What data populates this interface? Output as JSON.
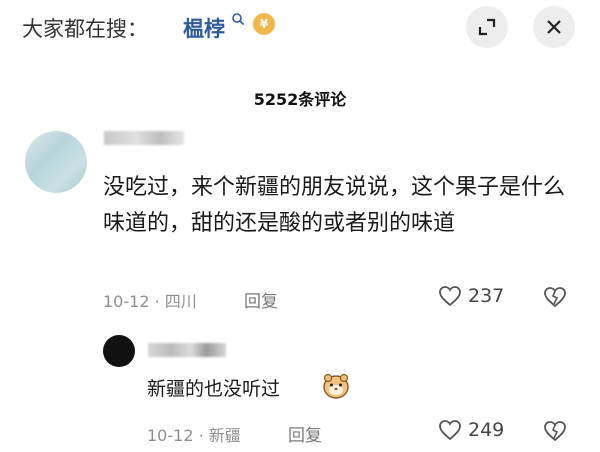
{
  "header": {
    "search_prefix": "大家都在搜：",
    "search_term": "榅桲",
    "coin_symbol": "¥"
  },
  "comments_title": "5252条评论",
  "comment": {
    "text": "没吃过，来个新疆的朋友说说，这个果子是什么味道的，甜的还是酸的或者别的味道",
    "meta": "10-12 · 四川",
    "reply_label": "回复",
    "likes": "237"
  },
  "reply": {
    "text": "新疆的也没听过",
    "meta": "10-12 · 新疆",
    "reply_label": "回复",
    "likes": "249"
  },
  "colors": {
    "search_term": "#2f5c9c",
    "coin": "#f2b84b",
    "button_bg": "#ededed"
  }
}
